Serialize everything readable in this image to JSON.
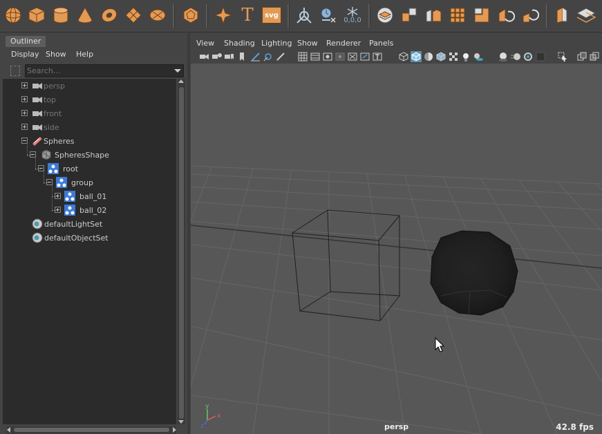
{
  "outliner": {
    "tab": "Outliner",
    "menu": [
      "Display",
      "Show",
      "Help"
    ],
    "search_placeholder": "Search...",
    "items": [
      {
        "label": "persp",
        "kind": "camera",
        "expanded": false
      },
      {
        "label": "top",
        "kind": "camera",
        "expanded": false
      },
      {
        "label": "front",
        "kind": "camera",
        "expanded": false
      },
      {
        "label": "side",
        "kind": "camera",
        "expanded": false
      },
      {
        "label": "Spheres",
        "kind": "transform",
        "expanded": true
      },
      {
        "label": "SpheresShape",
        "kind": "shape",
        "expanded": true
      },
      {
        "label": "root",
        "kind": "joint",
        "expanded": true
      },
      {
        "label": "group",
        "kind": "joint",
        "expanded": true
      },
      {
        "label": "ball_01",
        "kind": "joint",
        "expanded": false
      },
      {
        "label": "ball_02",
        "kind": "joint",
        "expanded": false
      },
      {
        "label": "defaultLightSet",
        "kind": "set"
      },
      {
        "label": "defaultObjectSet",
        "kind": "set"
      }
    ]
  },
  "shelf": {
    "items": [
      "sphere-icon",
      "cube-icon",
      "cylinder-icon",
      "cone-icon",
      "torus-icon",
      "plane-icon",
      "disc-icon",
      "platonic-icon",
      "sparkle-icon",
      "type-icon",
      "svg-icon",
      "locator-icon",
      "timer-icon",
      "freeze-icon",
      "combine-icon",
      "separate-icon",
      "extract-icon",
      "smooth-icon",
      "bevel-icon",
      "bridge-icon",
      "extrude-icon",
      "multi-cut-icon",
      "target-weld-icon"
    ],
    "svg_label": "SVG",
    "type_label": "T",
    "freeze_label": "0,0,0"
  },
  "viewport": {
    "menu": [
      "View",
      "Shading",
      "Lighting",
      "Show",
      "Renderer",
      "Panels"
    ],
    "camera_label": "persp",
    "fps": "42.8 fps",
    "axis": {
      "x": "x",
      "y": "y",
      "z": "z"
    }
  },
  "colors": {
    "shelf_accent": "#e39a55",
    "selected_tool": "#5f8ca7",
    "joint_icon": "#3d7bd6"
  }
}
